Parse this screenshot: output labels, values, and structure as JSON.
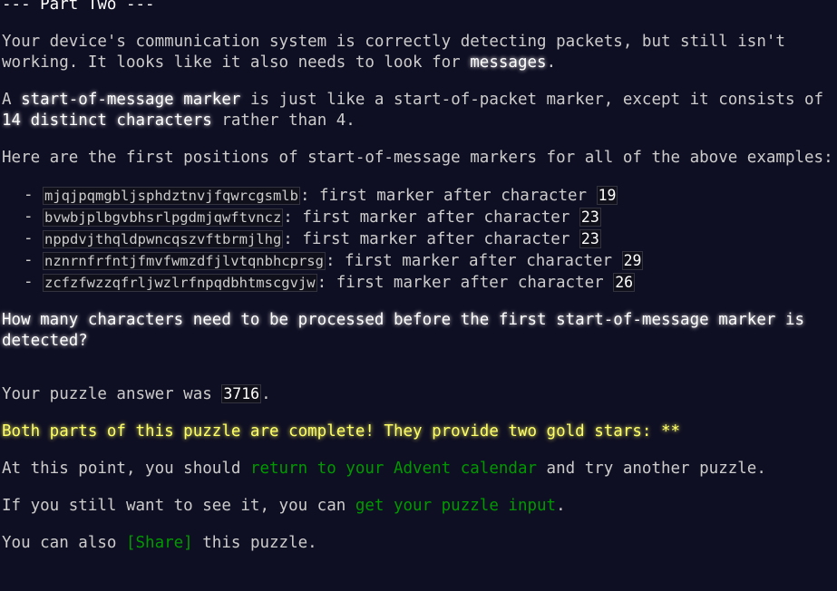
{
  "header": {
    "title": "--- Part Two ---"
  },
  "intro": {
    "text1": "Your device's communication system is correctly detecting packets, but still isn't working. It looks like it also needs to look for ",
    "em1": "messages",
    "text2": "."
  },
  "marker": {
    "text1": "A ",
    "em1": "start-of-message marker",
    "text2": " is just like a start-of-packet marker, except it consists of ",
    "em2": "14 distinct characters",
    "text3": " rather than 4."
  },
  "examples_intro": "Here are the first positions of start-of-message markers for all of the above examples:",
  "examples": [
    {
      "input": "mjqjpqmgbljsphdztnvjfqwrcgsmlb",
      "label": ": first marker after character ",
      "value": "19"
    },
    {
      "input": "bvwbjplbgvbhsrlpgdmjqwftvncz",
      "label": ": first marker after character ",
      "value": "23"
    },
    {
      "input": "nppdvjthqldpwncqszvftbrmjlhg",
      "label": ": first marker after character ",
      "value": "23"
    },
    {
      "input": "nznrnfrfntjfmvfwmzdfjlvtqnbhcprsg",
      "label": ": first marker after character ",
      "value": "29"
    },
    {
      "input": "zcfzfwzzqfrljwzlrfnpqdbhtmscgvjw",
      "label": ": first marker after character ",
      "value": "26"
    }
  ],
  "question": "How many characters need to be processed before the first start-of-message marker is detected?",
  "answer": {
    "prefix": "Your puzzle answer was ",
    "value": "3716",
    "suffix": "."
  },
  "complete": {
    "text": "Both parts of this puzzle are complete! They provide two gold stars: **"
  },
  "calendar": {
    "prefix": "At this point, you should ",
    "link": "return to your Advent calendar",
    "suffix": " and try another puzzle."
  },
  "input": {
    "prefix": "If you still want to see it, you can ",
    "link": "get your puzzle input",
    "suffix": "."
  },
  "share": {
    "prefix": "You can also ",
    "link": "[Share]",
    "suffix": " this puzzle."
  },
  "colors": {
    "background": "#0f0f23",
    "text": "#cccccc",
    "link": "#009900",
    "gold": "#ffff66"
  }
}
